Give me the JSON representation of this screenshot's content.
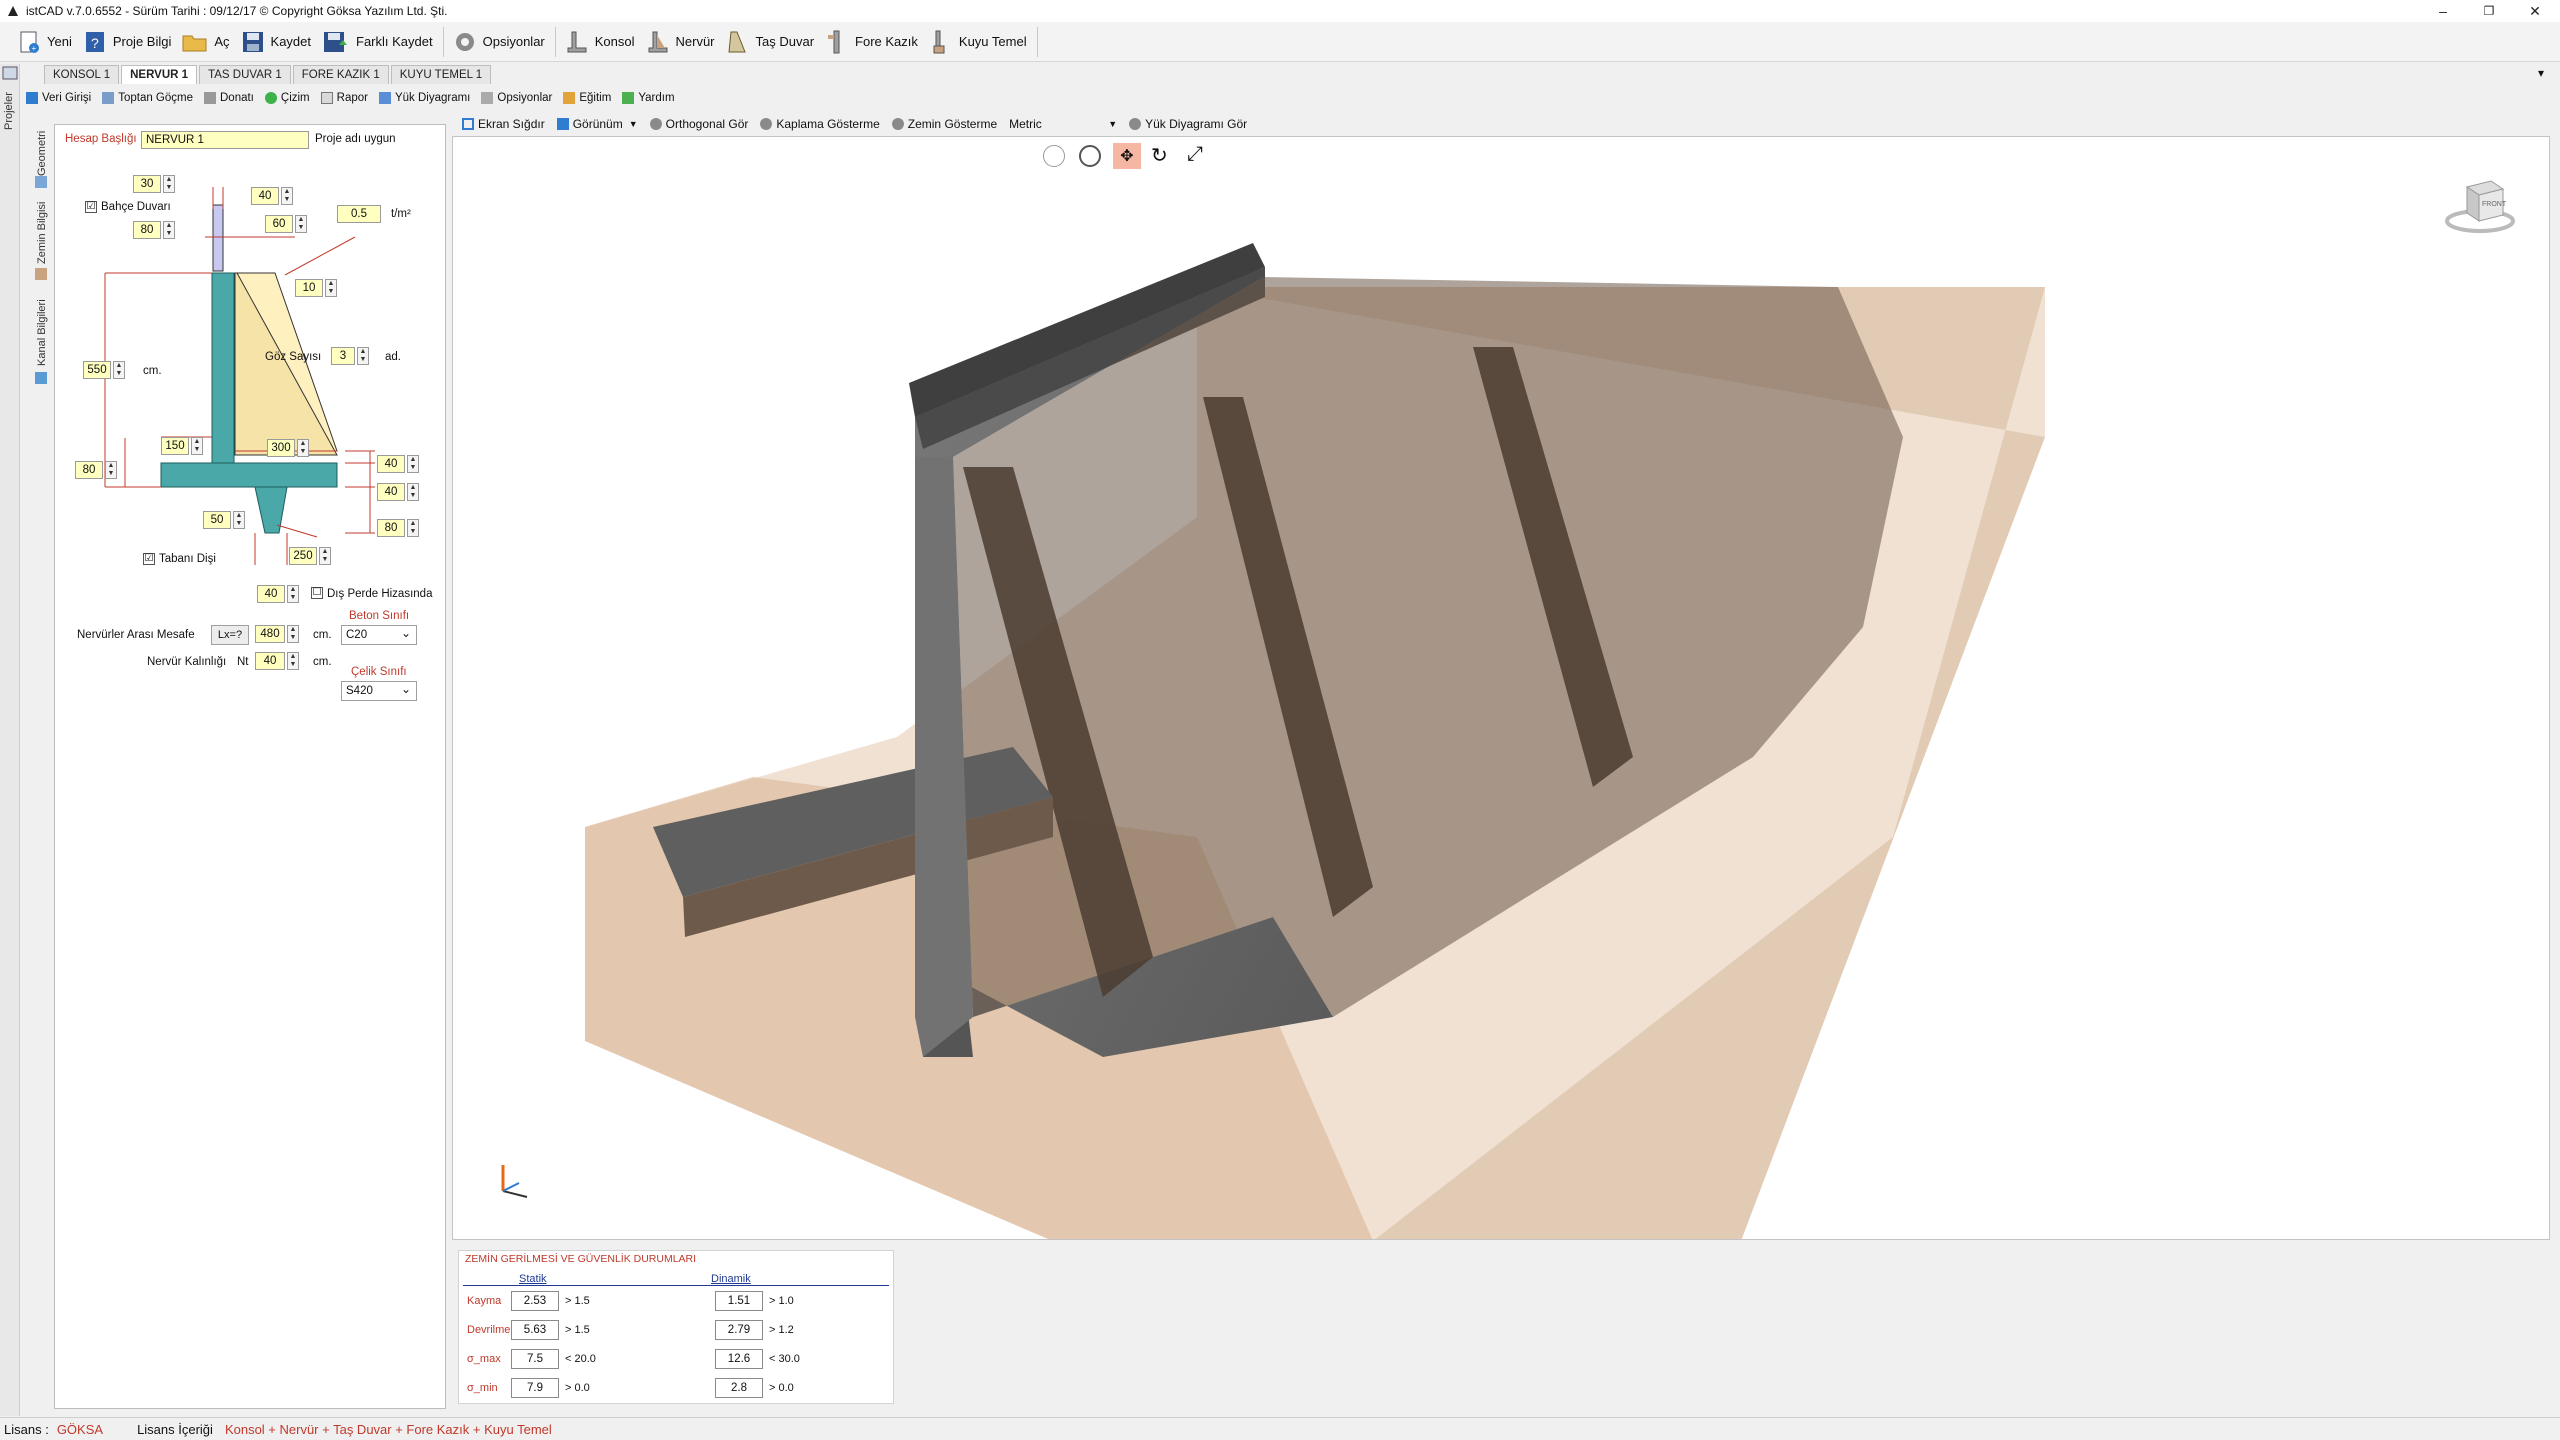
{
  "app": {
    "title": "istCAD v.7.0.6552 -  Sürüm Tarihi : 09/12/17  © Copyright Göksa Yazılım Ltd. Şti.",
    "window_buttons": [
      "–",
      "❐",
      "✕"
    ]
  },
  "toolbar": {
    "new": "Yeni",
    "project_info": "Proje Bilgi",
    "open": "Aç",
    "save": "Kaydet",
    "save_as": "Farklı Kaydet",
    "options": "Opsiyonlar",
    "konsol": "Konsol",
    "nervur": "Nervür",
    "tas_duvar": "Taş Duvar",
    "fore_kazik": "Fore Kazık",
    "kuyu_temel": "Kuyu Temel"
  },
  "left_strip": {
    "label": "Projeler"
  },
  "doc_tabs": [
    "KONSOL 1",
    "NERVUR 1",
    "TAS DUVAR 1",
    "FORE KAZIK 1",
    "KUYU TEMEL 1"
  ],
  "sub_toolbar": [
    "Veri Girişi",
    "Toptan Göçme",
    "Donatı",
    "Çizim",
    "Rapor",
    "Yük Diyagramı",
    "Opsiyonlar",
    "Eğitim",
    "Yardım"
  ],
  "side_tabs": [
    "Geometri",
    "Zemin Bilgisi",
    "Kanal Bilgileri"
  ],
  "panel": {
    "title_label": "Hesap Başlığı",
    "title_value": "NERVUR 1",
    "title_note": "Proje adı uygun",
    "garden_wall": "Bahçe Duvarı",
    "garden_wall_checked": "☑",
    "top_width": "30",
    "garden_h": "80",
    "dim_40a": "40",
    "dim_60": "60",
    "load": "0.5",
    "load_unit": "t/m²",
    "dim_10": "10",
    "height": "550",
    "height_unit": "cm.",
    "bays_label": "Göz Sayısı",
    "bays": "3",
    "bays_unit": "ad.",
    "toe_len": "150",
    "heel_len": "300",
    "base_t": "80",
    "r40a": "40",
    "r40b": "40",
    "r80": "80",
    "key_w": "50",
    "key_depth": "250",
    "key_label": "Tabanı Dişi",
    "key_checked": "☑",
    "bottom_40": "40",
    "outer_label": "Dış Perde Hizasında",
    "outer_checked": "☐",
    "rib_spacing_label": "Nervürler Arası Mesafe",
    "lx_btn": "Lx=?",
    "rib_spacing": "480",
    "cm1": "cm.",
    "rib_thick_label": "Nervür Kalınlığı",
    "nt": "Nt",
    "rib_thick": "40",
    "cm2": "cm.",
    "concrete_label": "Beton Sınıfı",
    "concrete": "C20",
    "steel_label": "Çelik Sınıfı",
    "steel": "S420"
  },
  "view_toolbar": {
    "fit": "Ekran Sığdır",
    "view": "Görünüm",
    "ortho": "Orthogonal Gör",
    "cover": "Kaplama Gösterme",
    "soil": "Zemin Gösterme",
    "units": "Metric",
    "load_diag": "Yük Diyagramı Gör"
  },
  "viewcube": {
    "face": "FRONT"
  },
  "results": {
    "title": "ZEMİN GERİLMESİ VE GÜVENLİK DURUMLARI",
    "static": "Statik",
    "dynamic": "Dinamik",
    "rows": [
      {
        "label": "Kayma",
        "s": "2.53",
        "sc": "> 1.5",
        "d": "1.51",
        "dc": "> 1.0"
      },
      {
        "label": "Devrilme",
        "s": "5.63",
        "sc": "> 1.5",
        "d": "2.79",
        "dc": "> 1.2"
      },
      {
        "label": "σ_max",
        "s": "7.5",
        "sc": "< 20.0",
        "d": "12.6",
        "dc": "< 30.0"
      },
      {
        "label": "σ_min",
        "s": "7.9",
        "sc": "> 0.0",
        "d": "2.8",
        "dc": "> 0.0"
      }
    ]
  },
  "status": {
    "license_label": "Lisans :",
    "license": "GÖKSA",
    "content_label": "Lisans İçeriği",
    "content": "Konsol + Nervür + Taş Duvar + Fore Kazık + Kuyu Temel"
  },
  "colors": {
    "accent_red": "#c0392b",
    "field_yellow": "#ffffc0",
    "wall_teal": "#4aa8a8",
    "soil_tan": "#c9a27f",
    "concrete": "#6b6b6b"
  }
}
